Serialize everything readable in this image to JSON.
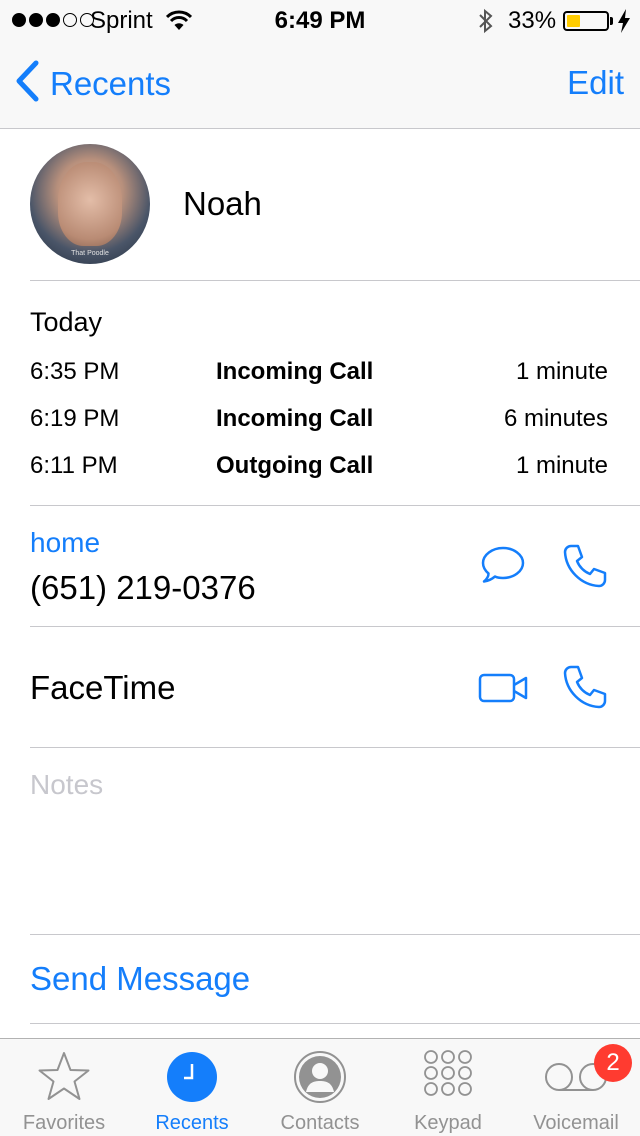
{
  "status_bar": {
    "carrier": "Sprint",
    "time": "6:49 PM",
    "battery_percent": "33%",
    "battery_level": 0.33,
    "signal_bars_filled": 3,
    "signal_bars_total": 5
  },
  "nav": {
    "back_label": "Recents",
    "edit_label": "Edit"
  },
  "contact": {
    "name": "Noah",
    "avatar_caption": "That Poodle"
  },
  "history": {
    "heading": "Today",
    "calls": [
      {
        "time": "6:35 PM",
        "type": "Incoming Call",
        "duration": "1 minute"
      },
      {
        "time": "6:19 PM",
        "type": "Incoming Call",
        "duration": "6 minutes"
      },
      {
        "time": "6:11 PM",
        "type": "Outgoing Call",
        "duration": "1 minute"
      }
    ]
  },
  "phone": {
    "label": "home",
    "number": "(651) 219-0376"
  },
  "facetime": {
    "label": "FaceTime"
  },
  "notes": {
    "placeholder": "Notes"
  },
  "actions": {
    "send_message": "Send Message"
  },
  "tabbar": {
    "tabs": [
      {
        "label": "Favorites",
        "icon": "star-icon"
      },
      {
        "label": "Recents",
        "icon": "clock-icon"
      },
      {
        "label": "Contacts",
        "icon": "person-icon"
      },
      {
        "label": "Keypad",
        "icon": "keypad-icon"
      },
      {
        "label": "Voicemail",
        "icon": "voicemail-icon"
      }
    ],
    "active": "Recents",
    "voicemail_badge": "2"
  },
  "colors": {
    "accent": "#147efb",
    "badge": "#ff3b30",
    "battery": "#ffcc00",
    "inactive": "#929292"
  }
}
